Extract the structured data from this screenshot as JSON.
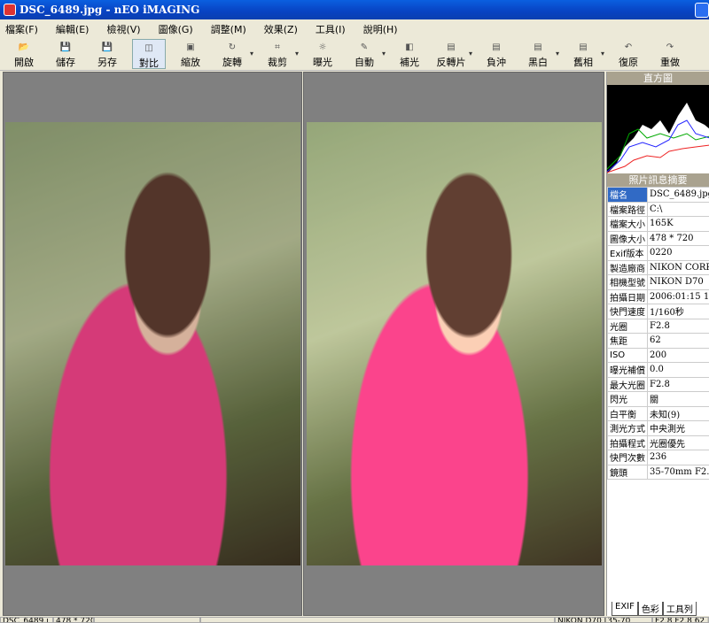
{
  "window": {
    "title": "DSC_6489.jpg - nEO iMAGING"
  },
  "menu": [
    "檔案(F)",
    "編輯(E)",
    "檢視(V)",
    "圖像(G)",
    "調整(M)",
    "效果(Z)",
    "工具(I)",
    "說明(H)"
  ],
  "toolbar": [
    {
      "label": "開啟",
      "icon": "folder-open-icon",
      "glyph": "📂"
    },
    {
      "label": "儲存",
      "icon": "save-icon",
      "glyph": "💾"
    },
    {
      "label": "另存",
      "icon": "save-as-icon",
      "glyph": "💾"
    },
    {
      "label": "對比",
      "icon": "compare-icon",
      "glyph": "◫",
      "active": true
    },
    {
      "label": "縮放",
      "icon": "resize-icon",
      "glyph": "▣"
    },
    {
      "label": "旋轉",
      "icon": "rotate-icon",
      "glyph": "↻",
      "dropdown": true
    },
    {
      "label": "裁剪",
      "icon": "crop-icon",
      "glyph": "⌗",
      "dropdown": true
    },
    {
      "label": "曝光",
      "icon": "exposure-icon",
      "glyph": "☼"
    },
    {
      "label": "自動",
      "icon": "auto-icon",
      "glyph": "✎",
      "dropdown": true
    },
    {
      "label": "補光",
      "icon": "fill-light-icon",
      "glyph": "◧"
    },
    {
      "label": "反轉片",
      "icon": "slide-film-icon",
      "glyph": "▤",
      "dropdown": true
    },
    {
      "label": "負沖",
      "icon": "cross-process-icon",
      "glyph": "▤"
    },
    {
      "label": "黑白",
      "icon": "black-white-icon",
      "glyph": "▤",
      "dropdown": true
    },
    {
      "label": "舊相",
      "icon": "sepia-icon",
      "glyph": "▤",
      "dropdown": true
    },
    {
      "label": "復原",
      "icon": "undo-icon",
      "glyph": "↶"
    },
    {
      "label": "重做",
      "icon": "redo-icon",
      "glyph": "↷"
    }
  ],
  "side": {
    "histogram_title": "直方圖",
    "info_title": "照片訊息摘要",
    "rows": [
      [
        "檔名",
        "DSC_6489.jpg"
      ],
      [
        "檔案路徑",
        "C:\\"
      ],
      [
        "檔案大小",
        "165K"
      ],
      [
        "圖像大小",
        "478 * 720"
      ],
      [
        "Exif版本",
        "0220"
      ],
      [
        "製造廠商",
        "NIKON CORPORATION"
      ],
      [
        "相機型號",
        "NIKON D70"
      ],
      [
        "拍攝日期",
        "2006:01:15 15:"
      ],
      [
        "快門速度",
        "1/160秒"
      ],
      [
        "光圈",
        "F2.8"
      ],
      [
        "焦距",
        "62"
      ],
      [
        "ISO",
        "200"
      ],
      [
        "曝光補償",
        "0.0"
      ],
      [
        "最大光圈",
        "F2.8"
      ],
      [
        "閃光",
        "關"
      ],
      [
        "白平衡",
        "未知(9)"
      ],
      [
        "測光方式",
        "中央測光"
      ],
      [
        "拍攝程式",
        "光圈優先"
      ],
      [
        "快門次數",
        "236"
      ],
      [
        "鏡頭",
        "35-70mm F2.8"
      ]
    ],
    "tabs": [
      "EXIF",
      "色彩",
      "工具列"
    ]
  },
  "status": [
    "DSC_6489.j",
    "478 * 720",
    "",
    "",
    "NIKON D70 [35-70",
    "F2.8 F2.8 62 F2.8 1/160"
  ]
}
